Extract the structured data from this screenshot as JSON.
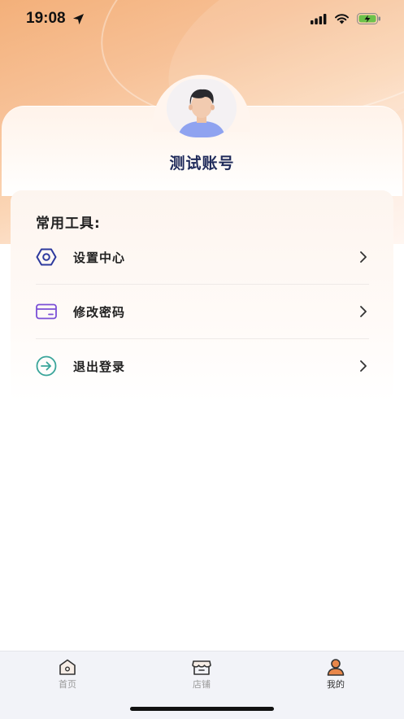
{
  "status_bar": {
    "time": "19:08"
  },
  "profile": {
    "username": "测试账号"
  },
  "tools": {
    "title": "常用工具:",
    "items": [
      {
        "label": "设置中心",
        "icon": "settings-hexagon-icon",
        "color": "#2d3a9e"
      },
      {
        "label": "修改密码",
        "icon": "card-icon",
        "color": "#7b4fd6"
      },
      {
        "label": "退出登录",
        "icon": "logout-arrow-icon",
        "color": "#3aa59a"
      }
    ]
  },
  "tabbar": {
    "tabs": [
      {
        "label": "首页",
        "icon": "home-icon",
        "active": false
      },
      {
        "label": "店铺",
        "icon": "store-icon",
        "active": false
      },
      {
        "label": "我的",
        "icon": "profile-icon",
        "active": true
      }
    ]
  },
  "colors": {
    "accent": "#e9874a",
    "title": "#1f2a5a"
  }
}
